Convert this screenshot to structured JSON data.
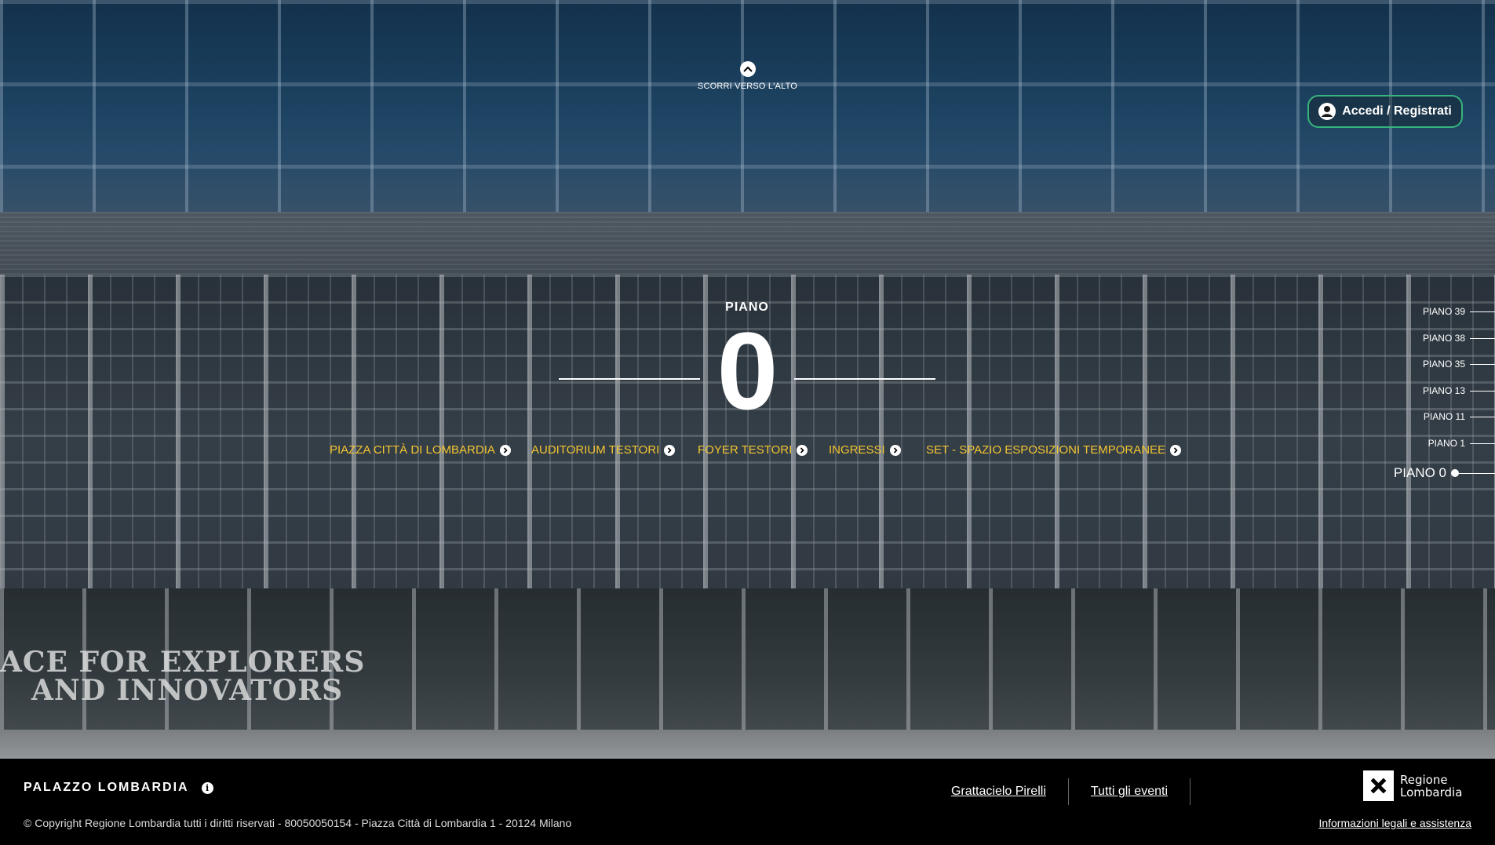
{
  "scroll_up": {
    "label": "SCORRI VERSO L'ALTO",
    "icon": "chevron-up-icon"
  },
  "login": {
    "label": "Accedi / Registrati",
    "icon": "user-circle-icon",
    "border_color": "#36b37e"
  },
  "floor": {
    "label": "PIANO",
    "number": "0"
  },
  "areas": [
    {
      "label": "PIAZZA CITTÀ DI LOMBARDIA"
    },
    {
      "label": "AUDITORIUM TESTORI"
    },
    {
      "label": "FOYER TESTORI"
    },
    {
      "label": "INGRESSI"
    },
    {
      "label": "SET - SPAZIO ESPOSIZIONI TEMPORANEE"
    }
  ],
  "area_link_color": "#f4c531",
  "floor_nav": [
    {
      "label": "PIANO 39",
      "active": false
    },
    {
      "label": "PIANO 38",
      "active": false
    },
    {
      "label": "PIANO 35",
      "active": false
    },
    {
      "label": "PIANO 13",
      "active": false
    },
    {
      "label": "PIANO 11",
      "active": false
    },
    {
      "label": "PIANO 1",
      "active": false
    },
    {
      "label": "PIANO 0",
      "active": true
    }
  ],
  "hero_signage": {
    "wall_text_line1": "ACE FOR EXPLORERS",
    "wall_text_line2": "AND INNOVATORS"
  },
  "footer": {
    "brand": "PALAZZO LOMBARDIA",
    "info_icon": "info-icon",
    "links": [
      "Grattacielo Pirelli",
      "Tutti gli eventi"
    ],
    "logo_text_line1": "Regione",
    "logo_text_line2": "Lombardia",
    "copyright": "© Copyright Regione Lombardia tutti i diritti riservati - 80050050154 - Piazza Città di Lombardia 1 - 20124 Milano",
    "legal": "Informazioni legali e assistenza"
  }
}
